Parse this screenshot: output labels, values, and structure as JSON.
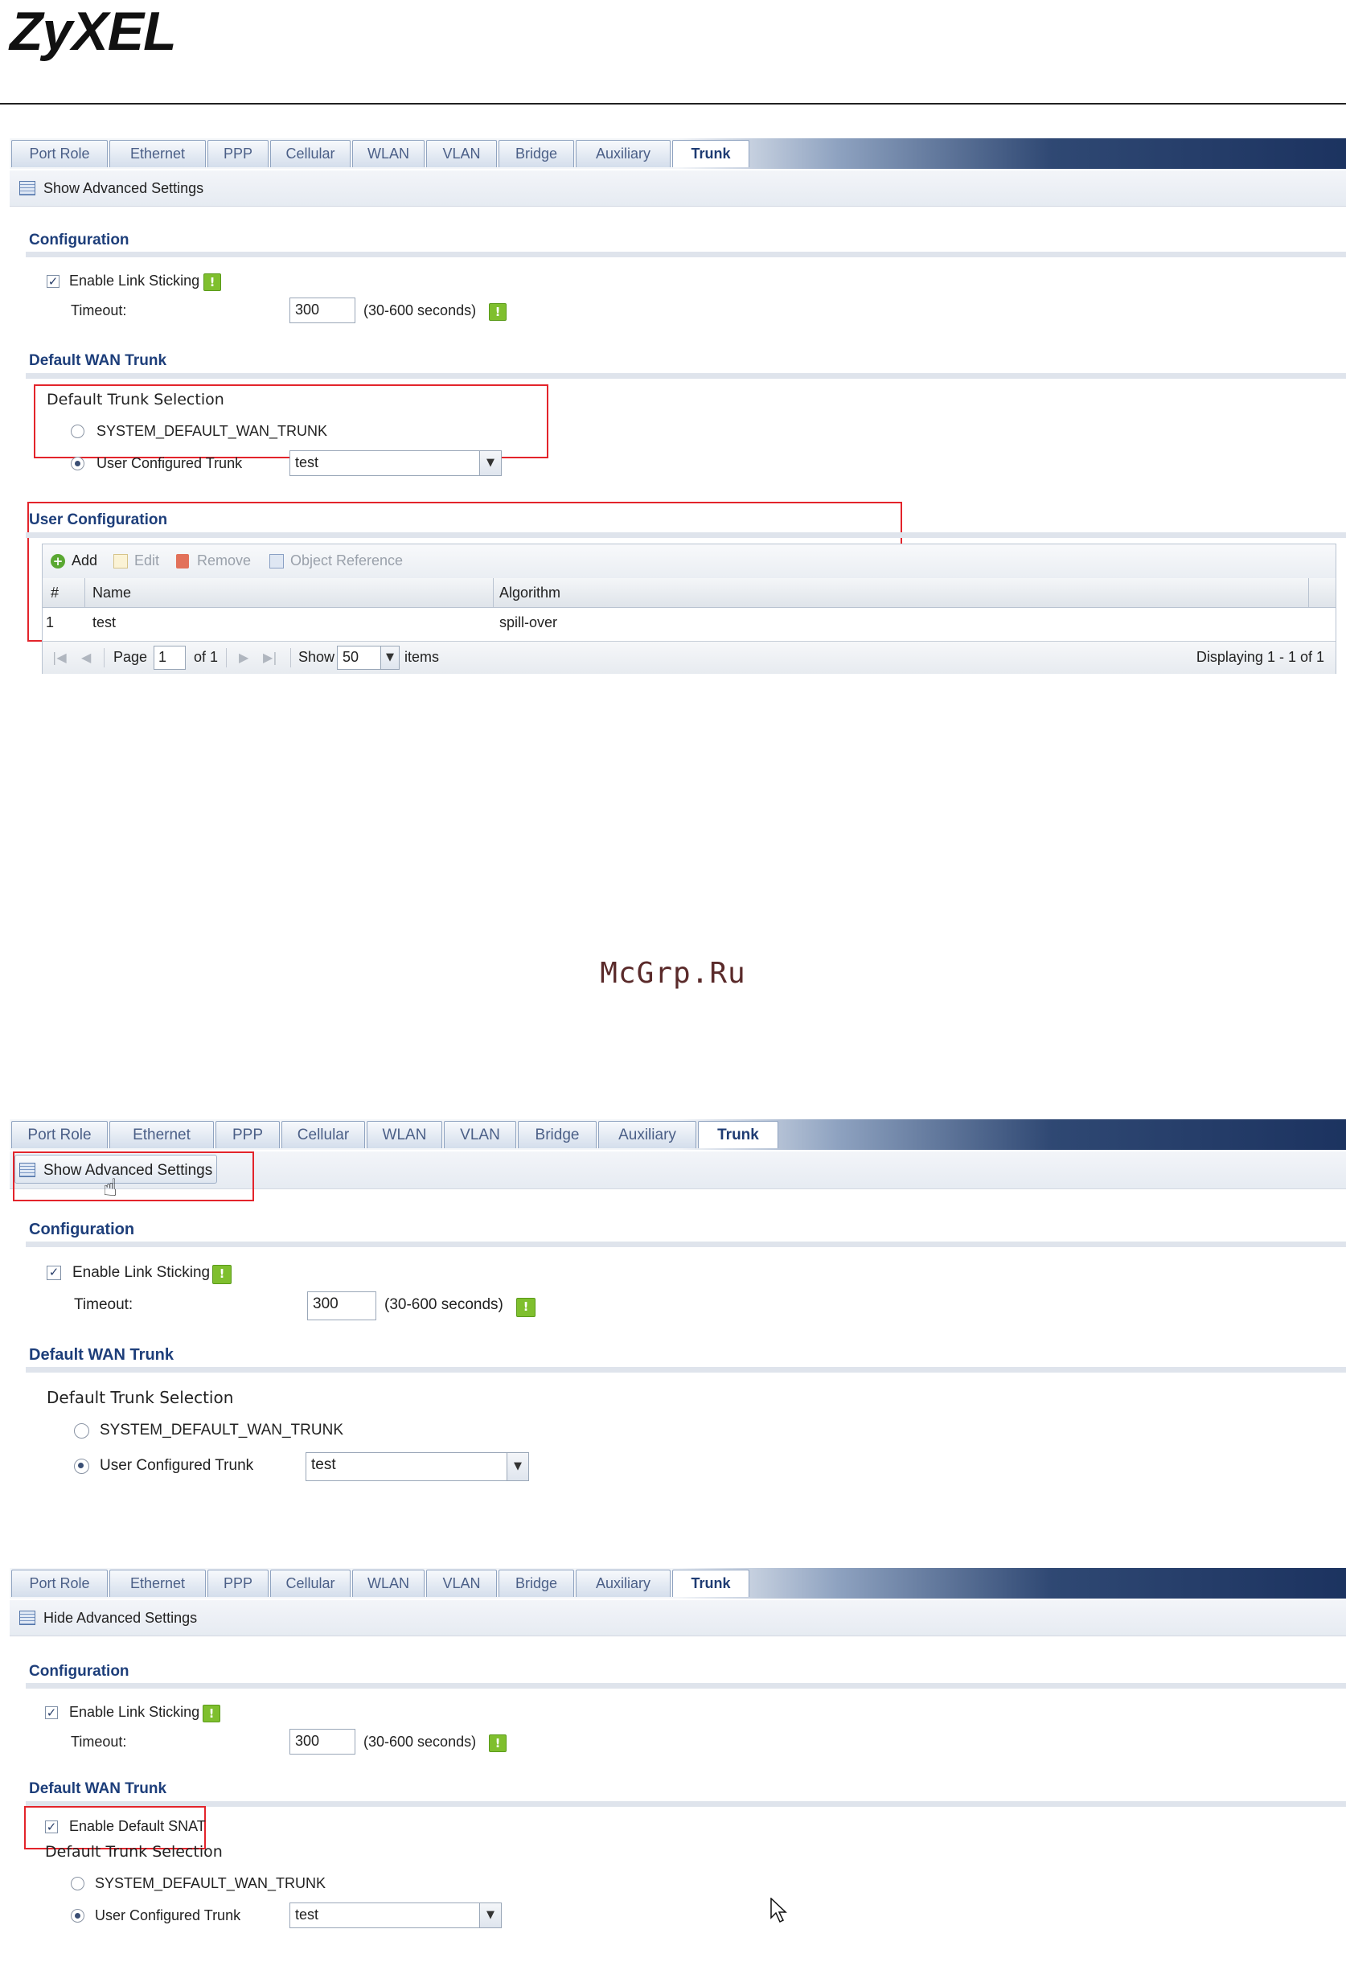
{
  "brand": {
    "logo": "ZyXEL"
  },
  "watermark": "McGrp.Ru",
  "tabs": [
    "Port Role",
    "Ethernet",
    "PPP",
    "Cellular",
    "WLAN",
    "VLAN",
    "Bridge",
    "Auxiliary",
    "Trunk"
  ],
  "active_tab": "Trunk",
  "panel1": {
    "adv_label": "Show Advanced Settings",
    "config_title": "Configuration",
    "link_sticking_label": "Enable Link Sticking",
    "link_sticking_checked": true,
    "timeout_label": "Timeout:",
    "timeout_value": "300",
    "timeout_hint": "(30-600 seconds)",
    "wan_title": "Default WAN Trunk",
    "trunk_selection_label": "Default Trunk Selection",
    "radio_system": "SYSTEM_DEFAULT_WAN_TRUNK",
    "radio_user": "User Configured Trunk",
    "trunk_select_value": "test",
    "user_config_title": "User Configuration",
    "toolbar": {
      "add": "Add",
      "edit": "Edit",
      "remove": "Remove",
      "object_reference": "Object Reference"
    },
    "columns": [
      "#",
      "Name",
      "Algorithm"
    ],
    "rows": [
      {
        "num": "1",
        "name": "test",
        "algorithm": "spill-over"
      }
    ],
    "pager": {
      "page_label": "Page",
      "page_value": "1",
      "of_label": "of 1",
      "show_label": "Show",
      "show_value": "50",
      "items_label": "items",
      "displaying": "Displaying 1 - 1 of 1"
    }
  },
  "panel2": {
    "adv_label": "Show Advanced Settings",
    "config_title": "Configuration",
    "link_sticking_label": "Enable Link Sticking",
    "timeout_label": "Timeout:",
    "timeout_value": "300",
    "timeout_hint": "(30-600 seconds)",
    "wan_title": "Default WAN Trunk",
    "trunk_selection_label": "Default Trunk Selection",
    "radio_system": "SYSTEM_DEFAULT_WAN_TRUNK",
    "radio_user": "User Configured Trunk",
    "trunk_select_value": "test"
  },
  "panel3": {
    "adv_label": "Hide Advanced Settings",
    "config_title": "Configuration",
    "link_sticking_label": "Enable Link Sticking",
    "timeout_label": "Timeout:",
    "timeout_value": "300",
    "timeout_hint": "(30-600 seconds)",
    "wan_title": "Default WAN Trunk",
    "snat_label": "Enable Default SNAT",
    "trunk_selection_label": "Default Trunk Selection",
    "radio_system": "SYSTEM_DEFAULT_WAN_TRUNK",
    "radio_user": "User Configured Trunk",
    "trunk_select_value": "test"
  },
  "colors": {
    "accent": "#1d3e7a",
    "highlight": "#e3242b",
    "help": "#7fbf2e"
  }
}
